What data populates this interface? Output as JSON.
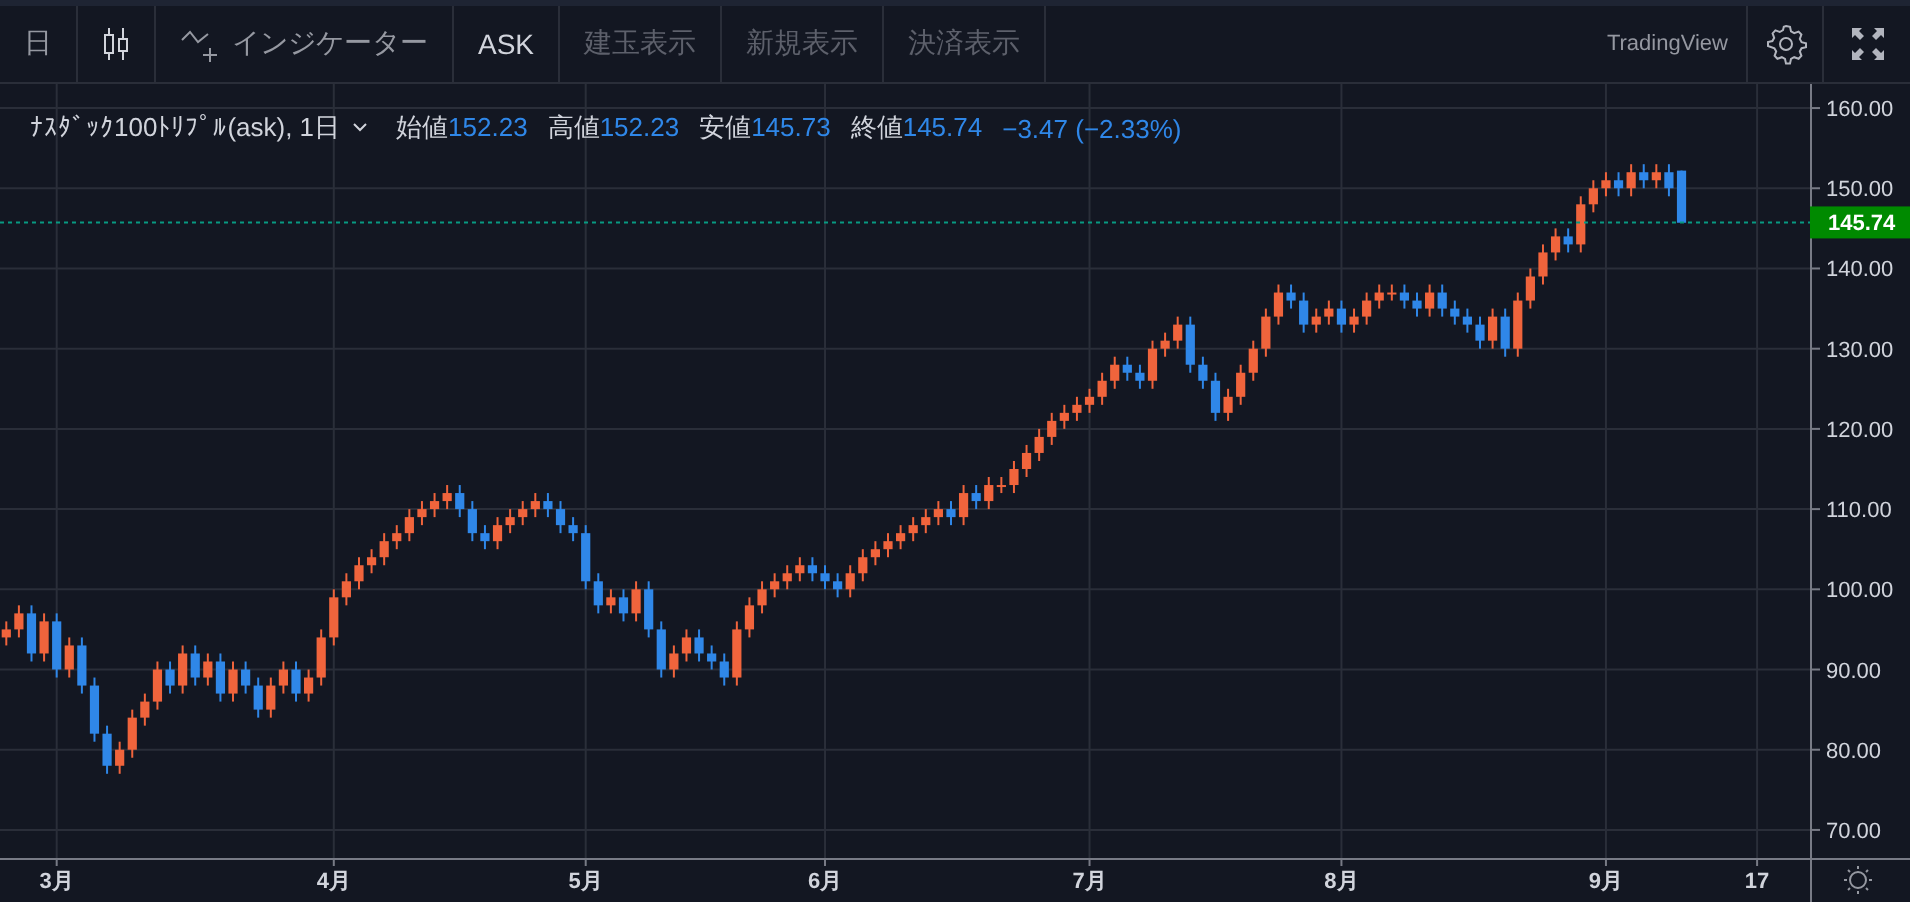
{
  "toolbar": {
    "items": [
      {
        "kind": "text",
        "label": "日",
        "disabled": false
      },
      {
        "kind": "chart-type",
        "disabled": false
      },
      {
        "kind": "indicators",
        "label": "インジケーター",
        "disabled": false
      },
      {
        "kind": "text",
        "label": "ASK",
        "disabled": false,
        "selected": true
      },
      {
        "kind": "text",
        "label": "建玉表示",
        "disabled": true
      },
      {
        "kind": "text",
        "label": "新規表示",
        "disabled": true
      },
      {
        "kind": "text",
        "label": "決済表示",
        "disabled": true
      }
    ],
    "brand": "TradingView"
  },
  "legend": {
    "title": "ﾅｽﾀﾞｯｸ100ﾄﾘﾌﾟﾙ(ask), 1日",
    "ohlc": [
      {
        "label": "始値",
        "value": "152.23"
      },
      {
        "label": "高値",
        "value": "152.23"
      },
      {
        "label": "安値",
        "value": "145.73"
      },
      {
        "label": "終値",
        "value": "145.74"
      }
    ],
    "change": "−3.47 (−2.33%)"
  },
  "chart_data": {
    "type": "candlestick",
    "grid": true,
    "ylim": [
      66.5,
      163
    ],
    "categories": [
      null,
      null,
      null,
      null,
      "3月",
      null,
      null,
      null,
      null,
      null,
      null,
      null,
      null,
      null,
      null,
      null,
      null,
      null,
      null,
      null,
      null,
      null,
      null,
      null,
      null,
      null,
      "4月",
      null,
      null,
      null,
      null,
      null,
      null,
      null,
      null,
      null,
      null,
      null,
      null,
      null,
      null,
      null,
      null,
      null,
      null,
      null,
      "5月",
      null,
      null,
      null,
      null,
      null,
      null,
      null,
      null,
      null,
      null,
      null,
      null,
      null,
      null,
      null,
      null,
      null,
      null,
      "6月",
      null,
      null,
      null,
      null,
      null,
      null,
      null,
      null,
      null,
      null,
      null,
      null,
      null,
      null,
      null,
      null,
      null,
      null,
      null,
      null,
      "7月",
      null,
      null,
      null,
      null,
      null,
      null,
      null,
      null,
      null,
      null,
      null,
      null,
      null,
      null,
      null,
      null,
      null,
      null,
      null,
      "8月",
      null,
      null,
      null,
      null,
      null,
      null,
      null,
      null,
      null,
      null,
      null,
      null,
      null,
      null,
      null,
      null,
      null,
      null,
      null,
      null,
      "9月",
      null,
      null,
      null,
      null,
      null,
      null,
      null,
      null,
      null,
      null,
      null,
      "17"
    ],
    "yticks": [
      {
        "value": 70,
        "label": "70.00"
      },
      {
        "value": 80,
        "label": "80.00"
      },
      {
        "value": 90,
        "label": "90.00"
      },
      {
        "value": 100,
        "label": "100.00"
      },
      {
        "value": 110,
        "label": "110.00"
      },
      {
        "value": 120,
        "label": "120.00"
      },
      {
        "value": 130,
        "label": "130.00"
      },
      {
        "value": 140,
        "label": "140.00"
      },
      {
        "value": 150,
        "label": "150.00"
      },
      {
        "value": 160,
        "label": "160.00"
      }
    ],
    "ref_lines": [
      {
        "axis": "y",
        "value": 145.74,
        "label": "145.74",
        "color": "#089981"
      }
    ],
    "ohlc": [
      [
        94,
        96,
        93,
        95
      ],
      [
        95,
        98,
        94,
        97
      ],
      [
        97,
        98,
        91,
        92
      ],
      [
        92,
        97,
        91,
        96
      ],
      [
        96,
        97,
        89,
        90
      ],
      [
        90,
        94,
        89,
        93
      ],
      [
        93,
        94,
        87,
        88
      ],
      [
        88,
        89,
        81,
        82
      ],
      [
        82,
        83,
        77,
        78
      ],
      [
        78,
        81,
        77,
        80
      ],
      [
        80,
        85,
        79,
        84
      ],
      [
        84,
        87,
        83,
        86
      ],
      [
        86,
        91,
        85,
        90
      ],
      [
        90,
        91,
        87,
        88
      ],
      [
        88,
        93,
        87,
        92
      ],
      [
        92,
        93,
        88,
        89
      ],
      [
        89,
        92,
        88,
        91
      ],
      [
        91,
        92,
        86,
        87
      ],
      [
        87,
        91,
        86,
        90
      ],
      [
        90,
        91,
        87,
        88
      ],
      [
        88,
        89,
        84,
        85
      ],
      [
        85,
        89,
        84,
        88
      ],
      [
        88,
        91,
        87,
        90
      ],
      [
        90,
        91,
        86,
        87
      ],
      [
        87,
        90,
        86,
        89
      ],
      [
        89,
        95,
        88,
        94
      ],
      [
        94,
        100,
        93,
        99
      ],
      [
        99,
        102,
        98,
        101
      ],
      [
        101,
        104,
        100,
        103
      ],
      [
        103,
        105,
        102,
        104
      ],
      [
        104,
        107,
        103,
        106
      ],
      [
        106,
        108,
        105,
        107
      ],
      [
        107,
        110,
        106,
        109
      ],
      [
        109,
        111,
        108,
        110
      ],
      [
        110,
        112,
        109,
        111
      ],
      [
        111,
        113,
        110,
        112
      ],
      [
        112,
        113,
        109,
        110
      ],
      [
        110,
        111,
        106,
        107
      ],
      [
        107,
        108,
        105,
        106
      ],
      [
        106,
        109,
        105,
        108
      ],
      [
        108,
        110,
        107,
        109
      ],
      [
        109,
        111,
        108,
        110
      ],
      [
        110,
        112,
        109,
        111
      ],
      [
        111,
        112,
        109,
        110
      ],
      [
        110,
        111,
        107,
        108
      ],
      [
        108,
        109,
        106,
        107
      ],
      [
        107,
        108,
        100,
        101
      ],
      [
        101,
        102,
        97,
        98
      ],
      [
        98,
        100,
        97,
        99
      ],
      [
        99,
        100,
        96,
        97
      ],
      [
        97,
        101,
        96,
        100
      ],
      [
        100,
        101,
        94,
        95
      ],
      [
        95,
        96,
        89,
        90
      ],
      [
        90,
        93,
        89,
        92
      ],
      [
        92,
        95,
        91,
        94
      ],
      [
        94,
        95,
        91,
        92
      ],
      [
        92,
        93,
        90,
        91
      ],
      [
        91,
        92,
        88,
        89
      ],
      [
        89,
        96,
        88,
        95
      ],
      [
        95,
        99,
        94,
        98
      ],
      [
        98,
        101,
        97,
        100
      ],
      [
        100,
        102,
        99,
        101
      ],
      [
        101,
        103,
        100,
        102
      ],
      [
        102,
        104,
        101,
        103
      ],
      [
        103,
        104,
        101,
        102
      ],
      [
        102,
        103,
        100,
        101
      ],
      [
        101,
        102,
        99,
        100
      ],
      [
        100,
        103,
        99,
        102
      ],
      [
        102,
        105,
        101,
        104
      ],
      [
        104,
        106,
        103,
        105
      ],
      [
        105,
        107,
        104,
        106
      ],
      [
        106,
        108,
        105,
        107
      ],
      [
        107,
        109,
        106,
        108
      ],
      [
        108,
        110,
        107,
        109
      ],
      [
        109,
        111,
        108,
        110
      ],
      [
        110,
        111,
        108,
        109
      ],
      [
        109,
        113,
        108,
        112
      ],
      [
        112,
        113,
        110,
        111
      ],
      [
        111,
        114,
        110,
        113
      ],
      [
        113,
        114,
        112,
        113
      ],
      [
        113,
        116,
        112,
        115
      ],
      [
        115,
        118,
        114,
        117
      ],
      [
        117,
        120,
        116,
        119
      ],
      [
        119,
        122,
        118,
        121
      ],
      [
        121,
        123,
        120,
        122
      ],
      [
        122,
        124,
        121,
        123
      ],
      [
        123,
        125,
        122,
        124
      ],
      [
        124,
        127,
        123,
        126
      ],
      [
        126,
        129,
        125,
        128
      ],
      [
        128,
        129,
        126,
        127
      ],
      [
        127,
        128,
        125,
        126
      ],
      [
        126,
        131,
        125,
        130
      ],
      [
        130,
        132,
        129,
        131
      ],
      [
        131,
        134,
        130,
        133
      ],
      [
        133,
        134,
        127,
        128
      ],
      [
        128,
        129,
        125,
        126
      ],
      [
        126,
        127,
        121,
        122
      ],
      [
        122,
        125,
        121,
        124
      ],
      [
        124,
        128,
        123,
        127
      ],
      [
        127,
        131,
        126,
        130
      ],
      [
        130,
        135,
        129,
        134
      ],
      [
        134,
        138,
        133,
        137
      ],
      [
        137,
        138,
        135,
        136
      ],
      [
        136,
        137,
        132,
        133
      ],
      [
        133,
        135,
        132,
        134
      ],
      [
        134,
        136,
        133,
        135
      ],
      [
        135,
        136,
        132,
        133
      ],
      [
        133,
        135,
        132,
        134
      ],
      [
        134,
        137,
        133,
        136
      ],
      [
        136,
        138,
        135,
        137
      ],
      [
        137,
        138,
        136,
        137
      ],
      [
        137,
        138,
        135,
        136
      ],
      [
        136,
        137,
        134,
        135
      ],
      [
        135,
        138,
        134,
        137
      ],
      [
        137,
        138,
        134,
        135
      ],
      [
        135,
        136,
        133,
        134
      ],
      [
        134,
        135,
        132,
        133
      ],
      [
        133,
        134,
        130,
        131
      ],
      [
        131,
        135,
        130,
        134
      ],
      [
        134,
        135,
        129,
        130
      ],
      [
        130,
        137,
        129,
        136
      ],
      [
        136,
        140,
        135,
        139
      ],
      [
        139,
        143,
        138,
        142
      ],
      [
        142,
        145,
        141,
        144
      ],
      [
        144,
        145,
        142,
        143
      ],
      [
        143,
        149,
        142,
        148
      ],
      [
        148,
        151,
        147,
        150
      ],
      [
        150,
        152,
        149,
        151
      ],
      [
        151,
        152,
        149,
        150
      ],
      [
        150,
        153,
        149,
        152
      ],
      [
        152,
        153,
        150,
        151
      ],
      [
        151,
        153,
        150,
        152
      ],
      [
        152,
        153,
        149,
        150
      ],
      [
        152.2,
        152.2,
        145.7,
        145.7
      ],
      null,
      null,
      null,
      null,
      null,
      null
    ]
  }
}
